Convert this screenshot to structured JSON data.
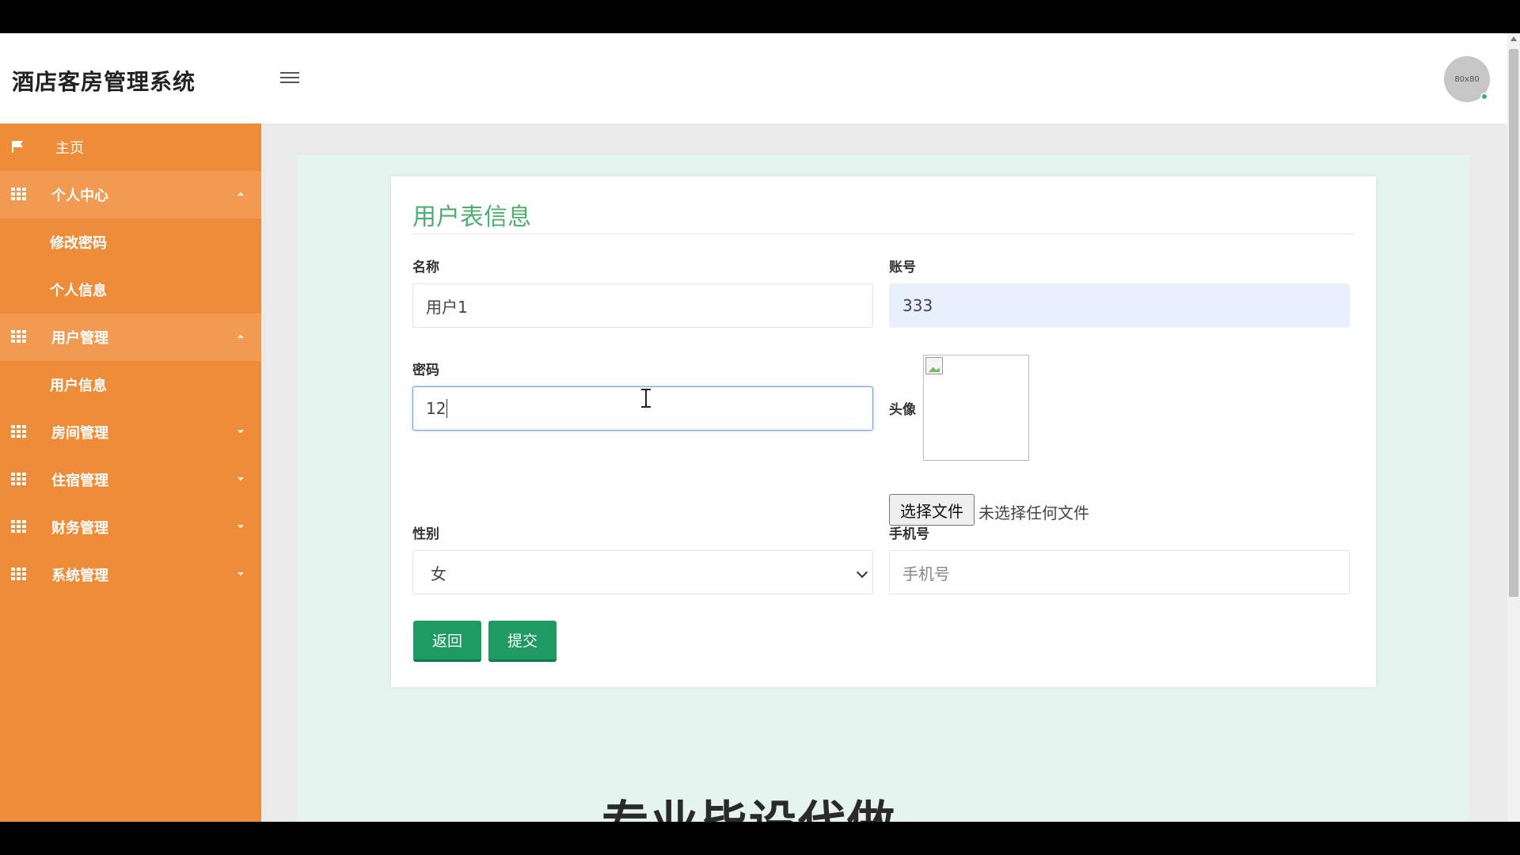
{
  "header": {
    "brand": "酒店客房管理系统",
    "avatar_text": "80x80"
  },
  "sidebar": {
    "items": [
      {
        "label": "主页",
        "icon": "flag-icon"
      },
      {
        "label": "个人中心",
        "icon": "grid-icon",
        "expanded": true,
        "children": [
          "修改密码",
          "个人信息"
        ]
      },
      {
        "label": "用户管理",
        "icon": "grid-icon",
        "expanded": true,
        "children": [
          "用户信息"
        ]
      },
      {
        "label": "房间管理",
        "icon": "grid-icon",
        "expanded": false
      },
      {
        "label": "住宿管理",
        "icon": "grid-icon",
        "expanded": false
      },
      {
        "label": "财务管理",
        "icon": "grid-icon",
        "expanded": false
      },
      {
        "label": "系统管理",
        "icon": "grid-icon",
        "expanded": false
      }
    ]
  },
  "form": {
    "title": "用户表信息",
    "name_label": "名称",
    "name_value": "用户1",
    "account_label": "账号",
    "account_value": "333",
    "password_label": "密码",
    "password_value": "12",
    "avatar_label": "头像",
    "file_button": "选择文件",
    "file_status": "未选择任何文件",
    "gender_label": "性别",
    "gender_value": "女",
    "phone_label": "手机号",
    "phone_placeholder": "手机号",
    "back_button": "返回",
    "submit_button": "提交"
  },
  "watermark": "专业毕设代做",
  "colors": {
    "sidebar": "#ee8c3a",
    "accent_green": "#1f9a63",
    "title_green": "#4caf6e"
  }
}
